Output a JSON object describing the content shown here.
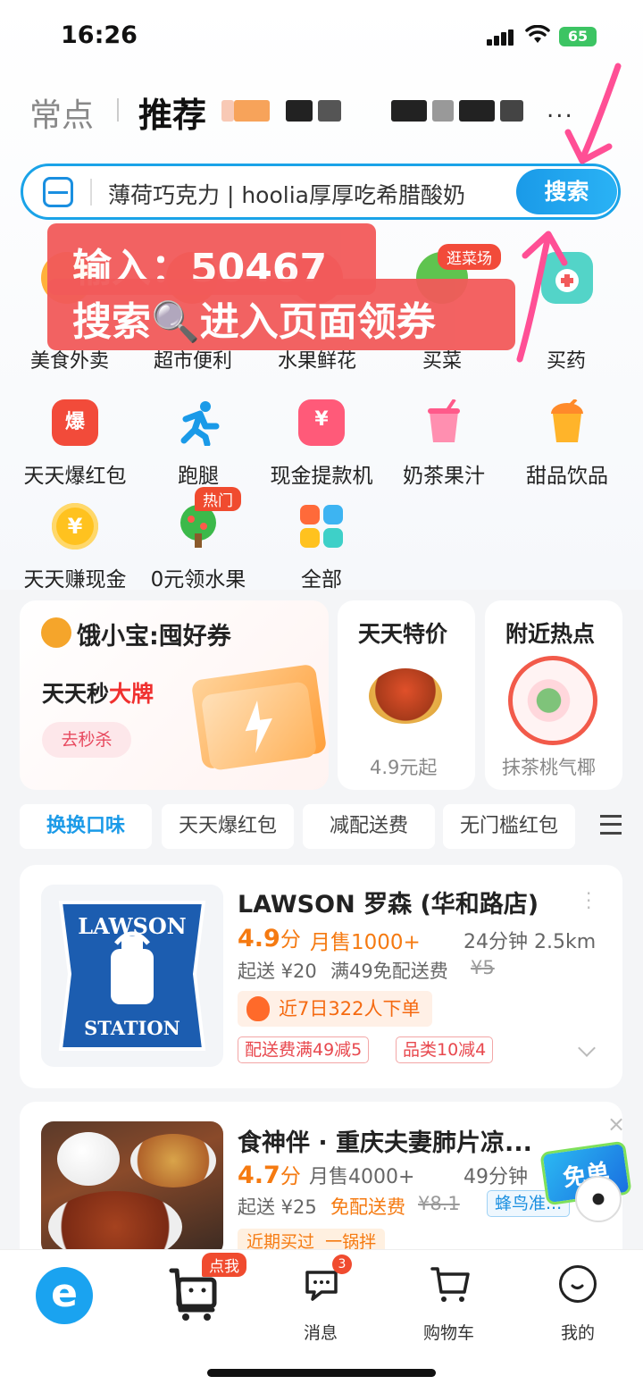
{
  "status_bar": {
    "time": "16:26",
    "battery": "65"
  },
  "header": {
    "tab_frequent": "常点",
    "tab_recommend": "推荐",
    "more": "..."
  },
  "search": {
    "query": "薄荷巧克力 | hoolia厚厚吃希腊酸奶",
    "button": "搜索"
  },
  "promo_overlay": {
    "line1": "输入：50467",
    "line2": "搜索🔍进入页面领券"
  },
  "categories_top": [
    {
      "label": "美食外卖"
    },
    {
      "label": "超市便利"
    },
    {
      "label": "水果鲜花"
    },
    {
      "label": "买菜"
    },
    {
      "label": "买药"
    }
  ],
  "market_tag": "逛菜场",
  "grid": [
    {
      "label": "天天爆红包",
      "icon": "red-packet-icon",
      "glyph": "爆"
    },
    {
      "label": "跑腿",
      "icon": "runner-icon",
      "glyph": ""
    },
    {
      "label": "现金提款机",
      "icon": "atm-icon",
      "glyph": "¥"
    },
    {
      "label": "奶茶果汁",
      "icon": "bubble-tea-icon",
      "glyph": ""
    },
    {
      "label": "甜品饮品",
      "icon": "dessert-drink-icon",
      "glyph": ""
    },
    {
      "label": "天天赚现金",
      "icon": "coin-icon",
      "glyph": "¥"
    },
    {
      "label": "0元领水果",
      "icon": "fruit-tree-icon",
      "glyph": ""
    },
    {
      "label": "全部",
      "icon": "all-apps-icon",
      "glyph": ""
    }
  ],
  "hot_badge": "热门",
  "ele_bao": {
    "brand": "饿小宝:囤好券",
    "title_prefix": "天天秒",
    "title_highlight": "大牌",
    "button": "去秒杀"
  },
  "special": {
    "title": "天天特价",
    "sub": "4.9元起"
  },
  "nearby": {
    "title": "附近热点",
    "sub": "抹茶桃气椰"
  },
  "filters": [
    "换换口味",
    "天天爆红包",
    "减配送费",
    "无门槛红包"
  ],
  "stores": [
    {
      "logo_top": "LAWSON",
      "logo_bottom": "STATION",
      "name": "LAWSON 罗森 (华和路店)",
      "rating": "4.9",
      "rating_unit": "分",
      "monthly": "月售1000+",
      "eta": "24分钟 2.5km",
      "min_order": "起送 ¥20",
      "free_delivery": "满49免配送费",
      "old_fee": "¥5",
      "popularity": "近7日322人下单",
      "coupons": [
        "配送费满49减5",
        "品类10减4"
      ]
    },
    {
      "name": "食神伴 · 重庆夫妻肺片凉...",
      "rating": "4.7",
      "rating_unit": "分",
      "monthly": "月售4000+",
      "eta": "49分钟",
      "min_order": "起送 ¥25",
      "free_delivery": "免配送费",
      "old_fee": "¥8.1",
      "delivery_tag": "蜂鸟准...",
      "recent": "近期买过",
      "recent_tag": "一锅拌",
      "promo_badge": "免单"
    }
  ],
  "bottom_nav": [
    {
      "label": ""
    },
    {
      "label": "",
      "badge": "点我"
    },
    {
      "label": "消息",
      "badge": "3"
    },
    {
      "label": "购物车"
    },
    {
      "label": "我的"
    }
  ],
  "colors": {
    "brand_blue": "#1aa3e8",
    "price_orange": "#f57a11",
    "red": "#f25a5a"
  }
}
